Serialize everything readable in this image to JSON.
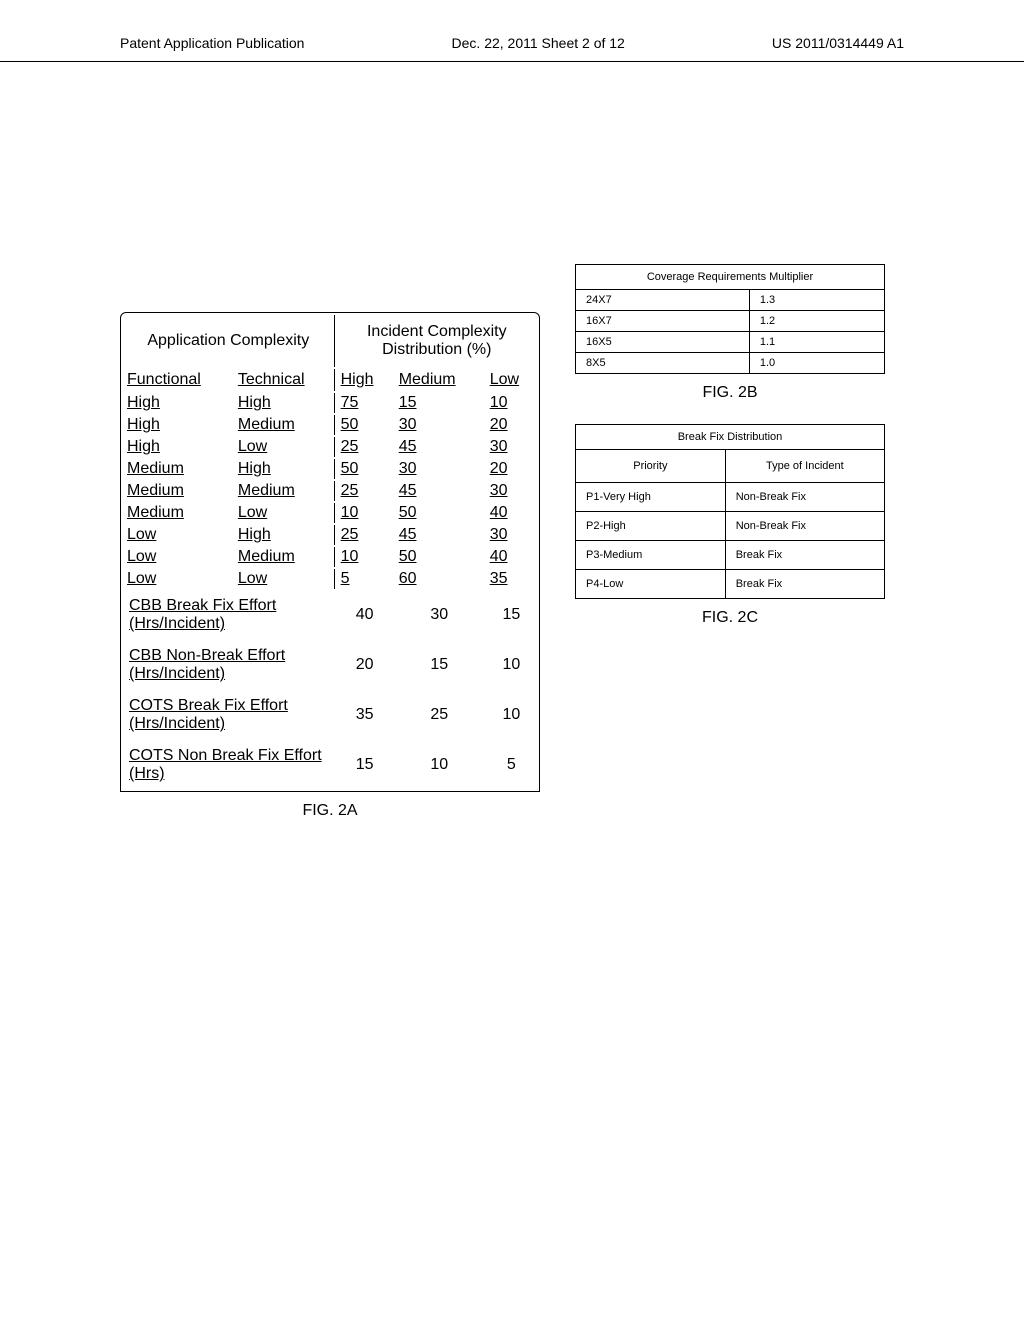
{
  "header": {
    "left": "Patent Application Publication",
    "center": "Dec. 22, 2011  Sheet 2 of 12",
    "right": "US 2011/0314449 A1"
  },
  "tableA": {
    "hdr_app": "Application Complexity",
    "hdr_inc": "Incident Complexity Distribution (%)",
    "sub1": "Functional",
    "sub2": "Technical",
    "sub3": "High",
    "sub4": "Medium",
    "sub5": "Low",
    "rows": [
      {
        "c1": "High",
        "c2": "High",
        "c3": "75",
        "c4": "15",
        "c5": "10"
      },
      {
        "c1": "High",
        "c2": "Medium",
        "c3": "50",
        "c4": "30",
        "c5": "20"
      },
      {
        "c1": "High",
        "c2": "Low",
        "c3": "25",
        "c4": "45",
        "c5": "30"
      },
      {
        "c1": "Medium",
        "c2": "High",
        "c3": "50",
        "c4": "30",
        "c5": "20"
      },
      {
        "c1": "Medium",
        "c2": "Medium",
        "c3": "25",
        "c4": "45",
        "c5": "30"
      },
      {
        "c1": "Medium",
        "c2": "Low",
        "c3": "10",
        "c4": "50",
        "c5": "40"
      },
      {
        "c1": "Low",
        "c2": "High",
        "c3": "25",
        "c4": "45",
        "c5": "30"
      },
      {
        "c1": "Low",
        "c2": "Medium",
        "c3": "10",
        "c4": "50",
        "c5": "40"
      },
      {
        "c1": "Low",
        "c2": "Low",
        "c3": "5",
        "c4": "60",
        "c5": "35"
      }
    ],
    "effort": [
      {
        "label": "CBB Break Fix Effort (Hrs/Incident)",
        "v1": "40",
        "v2": "30",
        "v3": "15"
      },
      {
        "label": "CBB Non-Break Effort (Hrs/Incident)",
        "v1": "20",
        "v2": "15",
        "v3": "10"
      },
      {
        "label": "COTS  Break Fix Effort (Hrs/Incident)",
        "v1": "35",
        "v2": "25",
        "v3": "10"
      },
      {
        "label": "COTS  Non Break Fix Effort (Hrs)",
        "v1": "15",
        "v2": "10",
        "v3": "5"
      }
    ],
    "caption": "FIG. 2A"
  },
  "tableB": {
    "title": "Coverage Requirements Multiplier",
    "rows": [
      {
        "k": "24X7",
        "v": "1.3"
      },
      {
        "k": "16X7",
        "v": "1.2"
      },
      {
        "k": "16X5",
        "v": "1.1"
      },
      {
        "k": "8X5",
        "v": "1.0"
      }
    ],
    "caption": "FIG. 2B"
  },
  "tableC": {
    "title": "Break Fix Distribution",
    "sub1": "Priority",
    "sub2": "Type of Incident",
    "rows": [
      {
        "k": "P1-Very High",
        "v": "Non-Break Fix"
      },
      {
        "k": "P2-High",
        "v": "Non-Break Fix"
      },
      {
        "k": "P3-Medium",
        "v": "Break Fix"
      },
      {
        "k": "P4-Low",
        "v": "Break Fix"
      }
    ],
    "caption": "FIG. 2C"
  }
}
